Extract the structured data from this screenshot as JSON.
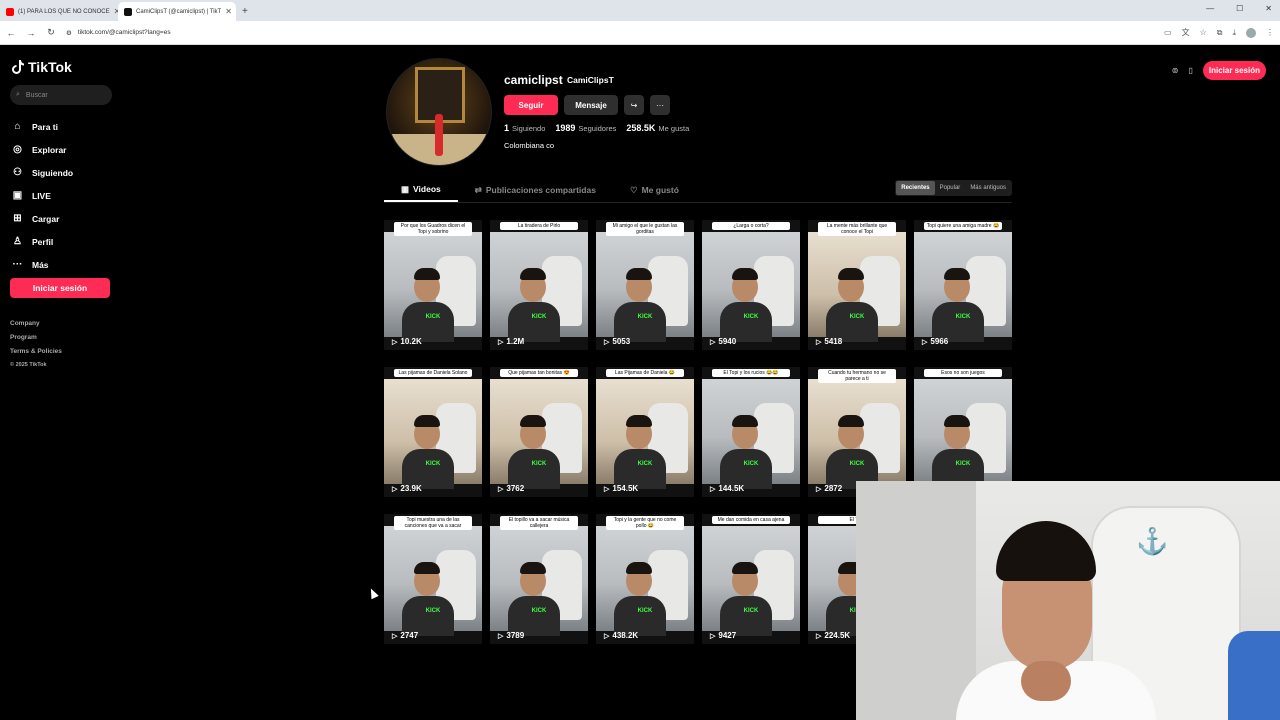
{
  "browser": {
    "tabs": [
      {
        "title": "(1) PARA LOS QUE NO CONOCE",
        "favicon_color": "#ff0000",
        "active": false
      },
      {
        "title": "CamiClipsT (@camiclipst) | TikT",
        "favicon_color": "#111111",
        "active": true
      }
    ],
    "url": "tiktok.com/@camiclipst?lang=es"
  },
  "sidebar": {
    "logo": "TikTok",
    "search_placeholder": "Buscar",
    "nav": [
      {
        "label": "Para ti",
        "icon": "home-icon"
      },
      {
        "label": "Explorar",
        "icon": "compass-icon"
      },
      {
        "label": "Siguiendo",
        "icon": "following-icon"
      },
      {
        "label": "LIVE",
        "icon": "live-icon"
      },
      {
        "label": "Cargar",
        "icon": "upload-icon"
      },
      {
        "label": "Perfil",
        "icon": "profile-icon"
      },
      {
        "label": "Más",
        "icon": "more-icon"
      }
    ],
    "login_label": "Iniciar sesión",
    "footer": [
      "Company",
      "Program",
      "Terms & Policies"
    ],
    "copyright": "© 2025 TikTok"
  },
  "header": {
    "login_label": "Iniciar sesión"
  },
  "profile": {
    "username": "camiclipst",
    "nickname": "CamiClipsT",
    "follow_label": "Seguir",
    "message_label": "Mensaje",
    "following_count": "1",
    "following_label": "Siguiendo",
    "followers_count": "1989",
    "followers_label": "Seguidores",
    "likes_count": "258.5K",
    "likes_label": "Me gusta",
    "bio": "Colombiana co"
  },
  "tabs": {
    "videos": "Videos",
    "reposts": "Publicaciones compartidas",
    "liked": "Me gustó",
    "sort": [
      "Recientes",
      "Popular",
      "Más antiguos"
    ]
  },
  "videos": [
    [
      {
        "caption": "Por que los Guadros dicen el Topi y sobrino",
        "views": "10.2K"
      },
      {
        "caption": "La tiradera de Pirlo",
        "views": "1.2M"
      },
      {
        "caption": "Mi amigo el que le gustan las gorditas",
        "views": "5053"
      },
      {
        "caption": "¿Larga o corta?",
        "views": "5940"
      },
      {
        "caption": "La mente más brillante que conoce el Topi",
        "views": "5418"
      },
      {
        "caption": "Topi quiere una amiga madre 😂",
        "views": "5966"
      }
    ],
    [
      {
        "caption": "Las pijamas de Daniela Solano",
        "views": "23.9K"
      },
      {
        "caption": "Que pijamas tan bonitas 😍",
        "views": "3762"
      },
      {
        "caption": "Las Pijamas de Daniela 😂",
        "views": "154.5K"
      },
      {
        "caption": "El Topi y los rucios 😂😂",
        "views": "144.5K"
      },
      {
        "caption": "Cuando tu hermano no se parece a ti",
        "views": "2872"
      },
      {
        "caption": "Esos no son juegos",
        "views": ""
      }
    ],
    [
      {
        "caption": "Topi muestra una de las canciones que va a sacar",
        "views": "2747"
      },
      {
        "caption": "El topillo va a sacar música callejera",
        "views": "3789"
      },
      {
        "caption": "Topi y la gente que no come pollo 😂",
        "views": "438.2K"
      },
      {
        "caption": "Me dan comida en casa ajena",
        "views": "9427"
      },
      {
        "caption": "El Topi",
        "views": "224.5K"
      }
    ]
  ],
  "overlay_text": {
    "kick": "KICK",
    "play": "▷"
  }
}
